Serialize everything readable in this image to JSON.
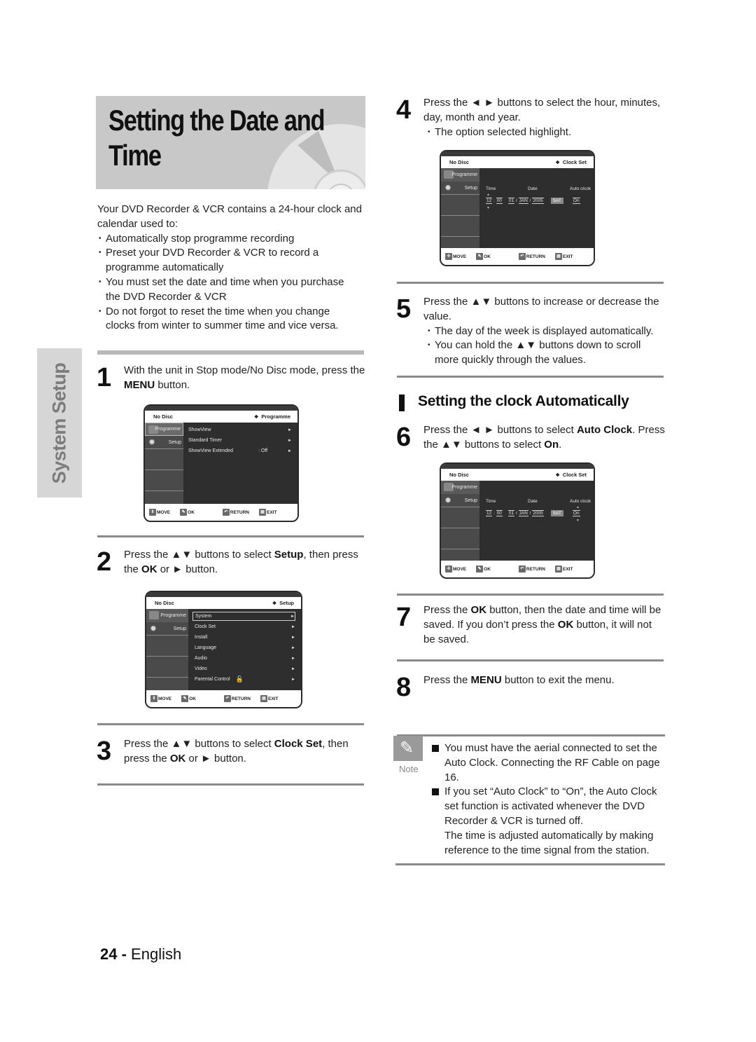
{
  "title": "Setting the Date and Time",
  "side_tab": "System Setup",
  "intro": {
    "paragraph": "Your DVD Recorder & VCR contains a 24-hour clock and calendar used to:",
    "bullets": [
      "Automatically stop programme recording",
      "Preset your DVD Recorder & VCR to record a programme automatically",
      "You must set the date and time when you purchase the DVD Recorder & VCR",
      "Do not forgot to reset the time when you change clocks from winter to summer time and vice versa."
    ]
  },
  "steps": [
    {
      "num": "1",
      "pre": "With the unit in Stop mode/No Disc mode, press the ",
      "b1": "MENU",
      "post": " button."
    },
    {
      "num": "2",
      "pre": "Press the ▲▼ buttons to select ",
      "b1": "Setup",
      "mid": ", then press the ",
      "b2": "OK",
      "post": " or ► button."
    },
    {
      "num": "3",
      "pre": "Press the ▲▼ buttons to select ",
      "b1": "Clock Set",
      "mid": ", then press the ",
      "b2": "OK",
      "post": " or ► button."
    },
    {
      "num": "4",
      "text": "Press the ◄ ► buttons to select the hour, minutes, day, month and year.",
      "bullets": [
        "The option selected highlight."
      ]
    },
    {
      "num": "5",
      "text": "Press the ▲▼ buttons to increase or decrease the value.",
      "bullets": [
        "The day of the week is displayed automatically.",
        "You can hold the ▲▼ buttons down to scroll more quickly through the values."
      ]
    },
    {
      "num": "6",
      "pre": "Press the ◄ ► buttons to select ",
      "b1": "Auto Clock",
      "mid": ". Press the ▲▼ buttons to select ",
      "b2": "On",
      "post": "."
    },
    {
      "num": "7",
      "pre": "Press the ",
      "b1": "OK",
      "mid": " button, then the date and time will be saved. If you don’t press the ",
      "b2": "OK",
      "post": " button, it will not be saved."
    },
    {
      "num": "8",
      "pre": "Press the ",
      "b1": "MENU",
      "post": " button to exit the menu."
    }
  ],
  "section_heading": "Setting the clock Automatically",
  "osd": {
    "no_disc": "No Disc",
    "tab_programme": "Programme",
    "tab_setup": "Setup",
    "footer": {
      "move": "MOVE",
      "ok": "OK",
      "return": "RETURN",
      "exit": "EXIT"
    },
    "menu1": {
      "location": "Programme",
      "items": [
        {
          "label": "ShowView",
          "value": ""
        },
        {
          "label": "Standard Timer",
          "value": ""
        },
        {
          "label": "ShowView Extended",
          "value": ": Off"
        }
      ]
    },
    "menu2": {
      "location": "Setup",
      "items": [
        "System",
        "Clock Set",
        "Install",
        "Language",
        "Audio",
        "Video",
        "Parental Control"
      ]
    },
    "clock": {
      "location": "Clock Set",
      "label_time": "Time",
      "label_date": "Date",
      "label_auto": "Auto clcok",
      "hour": "12",
      "minute": "00",
      "day": "01",
      "month": "JAN",
      "year": "2005",
      "weekday": "SAT",
      "auto": "On"
    }
  },
  "note": {
    "label": "Note",
    "items": [
      "You must have the aerial connected to set the Auto Clock. Connecting the RF Cable on page 16.",
      "If you set “Auto Clock” to “On”, the Auto Clock set function is activated whenever the DVD Recorder & VCR is turned off.\nThe time is adjusted automatically by making reference to the time signal from the station."
    ]
  },
  "footer": {
    "page_number": "24 -",
    "language": "English"
  }
}
